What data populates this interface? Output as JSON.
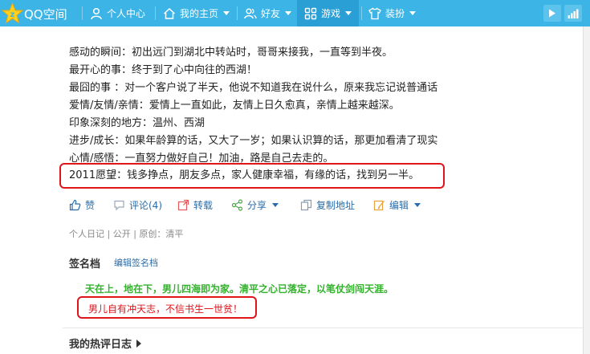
{
  "header": {
    "logo_text": "QQ空间",
    "nav": [
      {
        "label": "个人中心"
      },
      {
        "label": "我的主页"
      },
      {
        "label": "好友"
      },
      {
        "label": "游戏"
      },
      {
        "label": "装扮"
      }
    ]
  },
  "diary": {
    "lines": [
      "感动的瞬间：初出远门到湖北中转站时，哥哥来接我，一直等到半夜。",
      "最开心的事：终于到了心中向往的西湖！",
      "最囧的事 ：对一个客户说了半天，他说不知道我在说什么，原来我忘记说普通话",
      "爱情/友情/亲情：爱情上一直如此，友情上日久愈真，亲情上越来越深。",
      "印象深刻的地方：温州、西湖",
      "进步/成长：如果年龄算的话，又大了一岁；如果认识算的话，那更加看清了现实",
      "心情/感悟：一直努力做好自己！加油，路是自己去走的。"
    ],
    "highlight_line": "2011愿望：钱多挣点，朋友多点，家人健康幸福，有缘的话，找到另一半。"
  },
  "actions": {
    "like": "赞",
    "comment": "评论(4)",
    "repost": "转载",
    "share": "分享",
    "copy": "复制地址",
    "edit": "编辑"
  },
  "meta": "个人日记 | 公开 | 原创：清平",
  "signature": {
    "title": "签名档",
    "edit_link": "编辑签名档",
    "line1": "天在上，地在下，男儿四海即为家。清平之心已落定，以笔仗剑闯天涯。",
    "line2": "男儿自有冲天志，不信书生一世贫！"
  },
  "hot_comments": {
    "title": "我的热评日志"
  },
  "colors": {
    "topbar": "#3db4e6",
    "link": "#2b6ca8",
    "highlight_border": "#e0141b",
    "signature_green": "#33b22c"
  }
}
